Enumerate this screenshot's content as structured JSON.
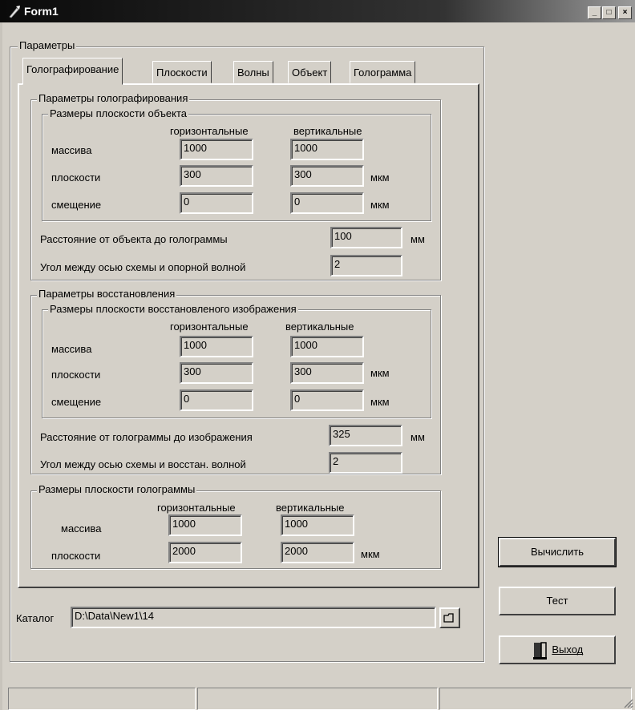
{
  "window": {
    "title": "Form1",
    "controls": {
      "minimize": "_",
      "maximize": "□",
      "close": "×"
    }
  },
  "params_group": {
    "label": "Параметры"
  },
  "tabs": [
    {
      "label": "Голографирование",
      "active": true
    },
    {
      "label": "Плоскости"
    },
    {
      "label": "Волны"
    },
    {
      "label": "Объект"
    },
    {
      "label": "Голограмма"
    }
  ],
  "holo": {
    "group_label": "Параметры голографирования",
    "object_plane": {
      "group_label": "Размеры плоскости объекта",
      "col_horizontal": "горизонтальные",
      "col_vertical": "вертикальные",
      "rows": [
        {
          "label": "массива",
          "h": "1000",
          "v": "1000",
          "unit": ""
        },
        {
          "label": "плоскости",
          "h": "300",
          "v": "300",
          "unit": "мкм"
        },
        {
          "label": "смещение",
          "h": "0",
          "v": "0",
          "unit": "мкм"
        }
      ]
    },
    "distance_label": "Расстояние от объекта до голограммы",
    "distance_value": "100",
    "distance_unit": "мм",
    "angle_label": "Угол между осью схемы и опорной волной",
    "angle_value": "2"
  },
  "recon": {
    "group_label": "Параметры восстановления",
    "image_plane": {
      "group_label": "Размеры плоскости восстановленого изображения",
      "col_horizontal": "горизонтальные",
      "col_vertical": "вертикальные",
      "rows": [
        {
          "label": "массива",
          "h": "1000",
          "v": "1000",
          "unit": ""
        },
        {
          "label": "плоскости",
          "h": "300",
          "v": "300",
          "unit": "мкм"
        },
        {
          "label": "смещение",
          "h": "0",
          "v": "0",
          "unit": "мкм"
        }
      ]
    },
    "distance_label": "Расстояние от голограммы до изображения",
    "distance_value": "325",
    "distance_unit": "мм",
    "angle_label": "Угол между осью схемы и восстан. волной",
    "angle_value": "2"
  },
  "hologram_plane": {
    "group_label": "Размеры плоскости голограммы",
    "col_horizontal": "горизонтальные",
    "col_vertical": "вертикальные",
    "rows": [
      {
        "label": "массива",
        "h": "1000",
        "v": "1000",
        "unit": ""
      },
      {
        "label": "плоскости",
        "h": "2000",
        "v": "2000",
        "unit": "мкм"
      }
    ]
  },
  "catalog": {
    "label": "Каталог",
    "value": "D:\\Data\\New1\\14"
  },
  "buttons": {
    "compute": "Вычислить",
    "test": "Тест",
    "exit": "Выход"
  }
}
